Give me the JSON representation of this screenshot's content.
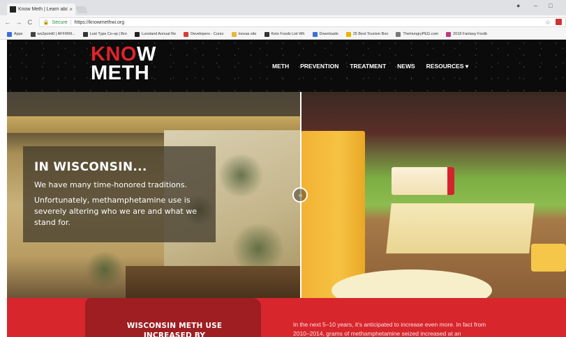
{
  "browser": {
    "tab_title": "Know Meth | Learn abou",
    "tab_close": "×",
    "secure_label": "Secure",
    "url": "https://knowmethwi.org",
    "bookmarks": [
      {
        "label": "Apps",
        "color": "#3b6fd6"
      },
      {
        "label": "ws2point0 | AFFIRM...",
        "color": "#444444"
      },
      {
        "label": "Lost Type Co-op | Bro",
        "color": "#333333"
      },
      {
        "label": "Lunsland Annual Re",
        "color": "#222222"
      },
      {
        "label": "Developers - Curso",
        "color": "#d83a3a"
      },
      {
        "label": "loovas site",
        "color": "#e6b93a"
      },
      {
        "label": "Keto Foods List Wh",
        "color": "#333333"
      },
      {
        "label": "Downloads",
        "color": "#3a6fd8"
      },
      {
        "label": "25 Best Tourism Boo",
        "color": "#e8b400"
      },
      {
        "label": "TheHungryPEG.com",
        "color": "#777777"
      },
      {
        "label": "2018 Fantasy Footb",
        "color": "#c23a73"
      }
    ]
  },
  "site": {
    "logo_line1_k": "K",
    "logo_line1_no": "NO",
    "logo_line1_w": "W",
    "logo_line2": "METH",
    "nav": [
      "METH",
      "PREVENTION",
      "TREATMENT",
      "NEWS",
      "RESOURCES ▾"
    ]
  },
  "hero": {
    "heading": "IN WISCONSIN...",
    "line1": "We have many time-honored traditions.",
    "line2": "Unfortunately, methamphetamine use is severely altering who we are and what we stand for.",
    "handle_glyph": "‹ ›"
  },
  "section": {
    "heading": "WISCONSIN METH USE INCREASED BY",
    "body": "In the next 5–10 years, it's anticipated to increase even more. In fact from 2010–2014, grams of methamphetamine seized increased at an"
  },
  "colors": {
    "brand_red": "#e0232b",
    "section_red": "#d8262d",
    "header_black": "#0b0b0b"
  }
}
